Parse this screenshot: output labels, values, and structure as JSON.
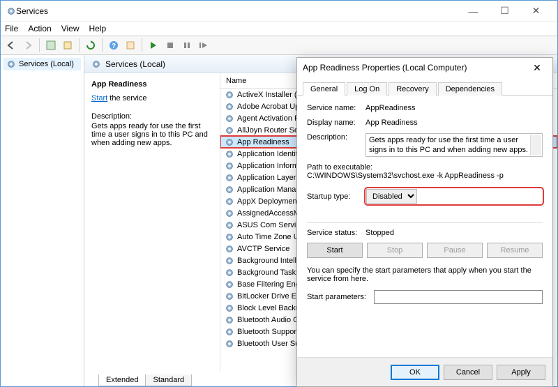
{
  "window": {
    "title": "Services"
  },
  "menu": {
    "file": "File",
    "action": "Action",
    "view": "View",
    "help": "Help"
  },
  "tree": {
    "root": "Services (Local)"
  },
  "content": {
    "header": "Services (Local)",
    "list_header": "Name"
  },
  "detail": {
    "name": "App Readiness",
    "start_link": "Start",
    "start_suffix": " the service",
    "desc_label": "Description:",
    "desc": "Gets apps ready for use the first time a user signs in to this PC and when adding new apps."
  },
  "services": [
    "ActiveX Installer (Ax",
    "Adobe Acrobat Upd",
    "Agent Activation Ru",
    "AllJoyn Router Servi",
    "App Readiness",
    "Application Identity",
    "Application Informa",
    "Application Layer G",
    "Application Manage",
    "AppX Deployment S",
    "AssignedAccessMan",
    "ASUS Com Service",
    "Auto Time Zone Up",
    "AVCTP Service",
    "Background Intellig",
    "Background Tasks In",
    "Base Filtering Engin",
    "BitLocker Drive Encr",
    "Block Level Backup",
    "Bluetooth Audio Ga",
    "Bluetooth Support S",
    "Bluetooth User Supp"
  ],
  "selected_index": 4,
  "tabs": {
    "extended": "Extended",
    "standard": "Standard"
  },
  "dialog": {
    "title": "App Readiness Properties (Local Computer)",
    "tabs": {
      "general": "General",
      "logon": "Log On",
      "recovery": "Recovery",
      "dependencies": "Dependencies"
    },
    "labels": {
      "service_name": "Service name:",
      "display_name": "Display name:",
      "description": "Description:",
      "path": "Path to executable:",
      "startup_type": "Startup type:",
      "service_status": "Service status:",
      "start_params": "Start parameters:"
    },
    "values": {
      "service_name": "AppReadiness",
      "display_name": "App Readiness",
      "description": "Gets apps ready for use the first time a user signs in to this PC and when adding new apps.",
      "path": "C:\\WINDOWS\\System32\\svchost.exe -k AppReadiness -p",
      "startup_type": "Disabled",
      "service_status": "Stopped",
      "hint": "You can specify the start parameters that apply when you start the service from here."
    },
    "buttons": {
      "start": "Start",
      "stop": "Stop",
      "pause": "Pause",
      "resume": "Resume",
      "ok": "OK",
      "cancel": "Cancel",
      "apply": "Apply"
    }
  }
}
